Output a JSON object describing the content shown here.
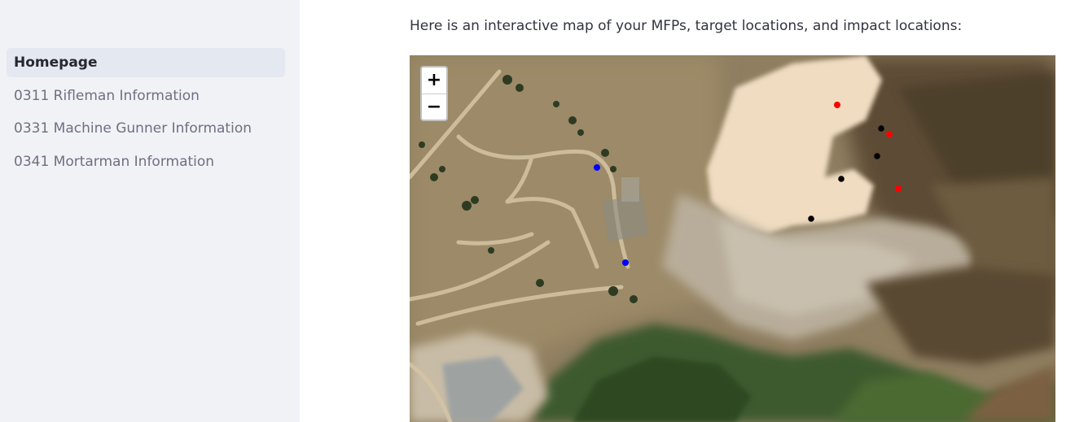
{
  "sidebar": {
    "items": [
      {
        "label": "Homepage",
        "active": true
      },
      {
        "label": "0311 Rifleman Information",
        "active": false
      },
      {
        "label": "0331 Machine Gunner Information",
        "active": false
      },
      {
        "label": "0341 Mortarman Information",
        "active": false
      }
    ]
  },
  "main": {
    "intro": "Here is an interactive map of your MFPs, target locations, and impact locations:"
  },
  "map": {
    "zoom_in": "+",
    "zoom_out": "−",
    "marker_colors": {
      "mfp": "#0000ff",
      "target": "#ff0000",
      "impact": "#000000"
    }
  }
}
